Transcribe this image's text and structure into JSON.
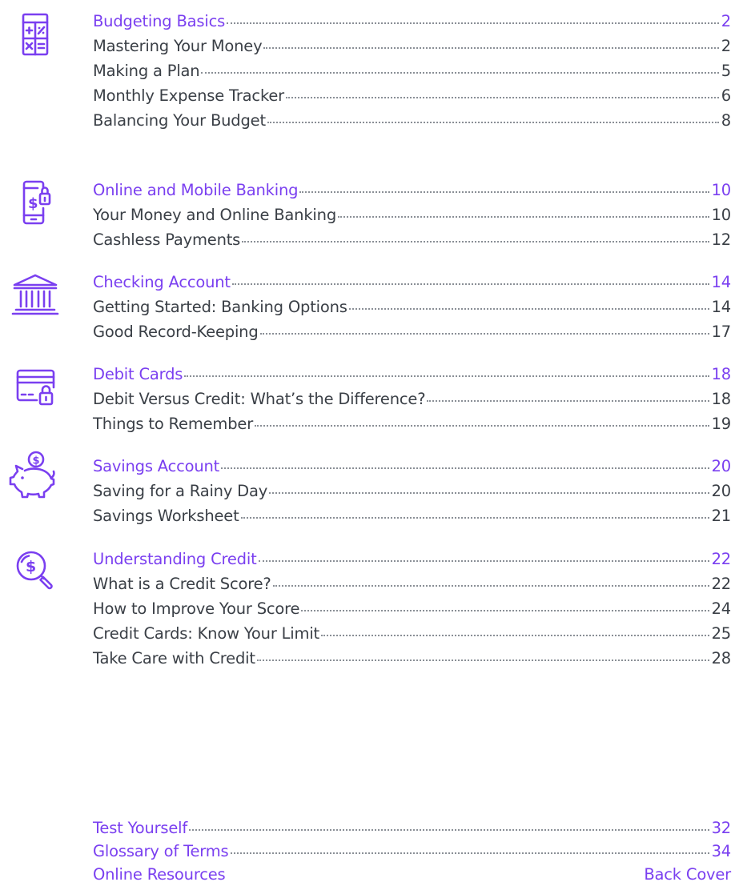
{
  "accent_color": "#7a3ff0",
  "text_color": "#3a3f46",
  "sections": [
    {
      "icon": "calculator-icon",
      "heading": {
        "label": "Budgeting Basics",
        "page": "2"
      },
      "items": [
        {
          "label": "Mastering Your Money",
          "page": "2"
        },
        {
          "label": "Making a Plan",
          "page": "5"
        },
        {
          "label": "Monthly Expense Tracker",
          "page": "6"
        },
        {
          "label": "Balancing Your Budget",
          "page": "8"
        }
      ]
    },
    {
      "icon": "mobile-banking-icon",
      "heading": {
        "label": "Online and Mobile Banking",
        "page": "10"
      },
      "items": [
        {
          "label": "Your Money and Online Banking",
          "page": "10"
        },
        {
          "label": "Cashless Payments",
          "page": "12"
        }
      ]
    },
    {
      "icon": "bank-icon",
      "heading": {
        "label": "Checking Account",
        "page": "14"
      },
      "items": [
        {
          "label": "Getting Started: Banking Options",
          "page": "14"
        },
        {
          "label": "Good Record-Keeping",
          "page": "17"
        }
      ]
    },
    {
      "icon": "debit-card-lock-icon",
      "heading": {
        "label": "Debit Cards",
        "page": "18"
      },
      "items": [
        {
          "label": "Debit Versus Credit: What’s the Difference?",
          "page": "18"
        },
        {
          "label": "Things to Remember",
          "page": "19"
        }
      ]
    },
    {
      "icon": "piggy-bank-icon",
      "heading": {
        "label": "Savings Account",
        "page": "20"
      },
      "items": [
        {
          "label": "Saving for a Rainy Day",
          "page": "20"
        },
        {
          "label": "Savings Worksheet",
          "page": "21"
        }
      ]
    },
    {
      "icon": "credit-search-icon",
      "heading": {
        "label": "Understanding Credit",
        "page": "22"
      },
      "items": [
        {
          "label": "What is a Credit Score?",
          "page": "22"
        },
        {
          "label": "How to Improve Your Score",
          "page": "24"
        },
        {
          "label": "Credit Cards: Know Your Limit",
          "page": "25"
        },
        {
          "label": "Take Care with Credit",
          "page": "28"
        }
      ]
    }
  ],
  "extras": [
    {
      "label": "Test Yourself",
      "page": "32"
    },
    {
      "label": "Glossary of Terms",
      "page": "34"
    },
    {
      "label": "Online Resources",
      "page": "Back Cover"
    }
  ]
}
